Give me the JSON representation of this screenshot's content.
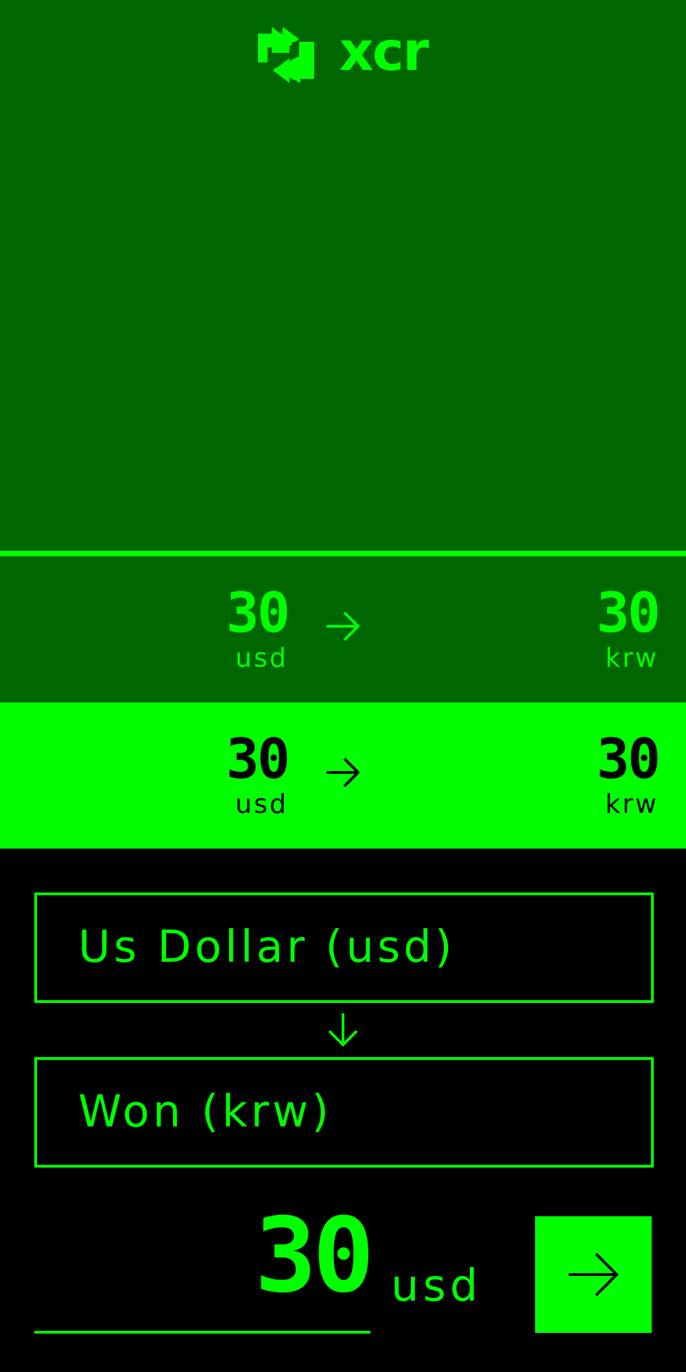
{
  "app": {
    "name": "xcr",
    "logo_icon": "exchange-arrows-icon"
  },
  "colors": {
    "accent": "#00ff00",
    "header_bg": "#006600",
    "panel_bg": "#000000"
  },
  "history": [
    {
      "from_amount": "30",
      "from_currency": "usd",
      "arrow_icon": "arrow-right-icon",
      "to_amount": "30",
      "to_currency": "krw",
      "highlighted": false
    },
    {
      "from_amount": "30",
      "from_currency": "usd",
      "arrow_icon": "arrow-right-icon",
      "to_amount": "30",
      "to_currency": "krw",
      "highlighted": true
    }
  ],
  "converter": {
    "from_select": "Us Dollar (usd)",
    "swap_icon": "arrow-down-icon",
    "to_select": "Won (krw)",
    "amount_value": "30",
    "amount_currency": "usd",
    "submit_icon": "arrow-right-icon"
  }
}
